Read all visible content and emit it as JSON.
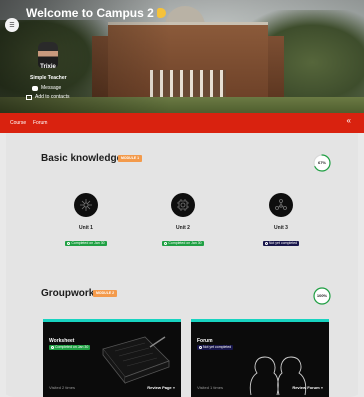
{
  "header": {
    "title": "Welcome to Campus 2",
    "menu_icon": "menu-icon",
    "wave_icon": "waving-hand-icon"
  },
  "profile": {
    "name": "Trixie",
    "role": "Simple Teacher",
    "message_label": "Message",
    "add_contact_label": "Add to contacts"
  },
  "tabs": [
    {
      "label": "Course",
      "active": true
    },
    {
      "label": "Forum",
      "active": false
    }
  ],
  "colors": {
    "tabbar": "#d9220f",
    "module_badge": "#f39a4b",
    "completed": "#1fa043",
    "not_completed": "#17154a",
    "card_accent": "#18d3c0",
    "progress_ring": "#1fa043"
  },
  "sections": [
    {
      "title": "Basic knowledge",
      "module_label": "MODULE 1",
      "progress": "67%",
      "progress_value": 0.67,
      "units": [
        {
          "label": "Unit 1",
          "status": "Completed on Jan 30",
          "completed": true,
          "icon": "network-icon"
        },
        {
          "label": "Unit 2",
          "status": "Completed on Jan 30",
          "completed": true,
          "icon": "gear-chip-icon"
        },
        {
          "label": "Unit 3",
          "status": "Not yet completed",
          "completed": false,
          "icon": "molecule-icon"
        }
      ]
    },
    {
      "title": "Groupwork",
      "module_label": "MODULE 2",
      "progress": "100%",
      "progress_value": 1.0,
      "cards": [
        {
          "title": "Worksheet",
          "status": "Completed on Jan 30",
          "completed": true,
          "visits": "Visited 2 times",
          "action": "Review Page »"
        },
        {
          "title": "Forum",
          "status": "Not yet completed",
          "completed": false,
          "visits": "Visited 1 times",
          "action": "Review Forum »"
        }
      ]
    }
  ]
}
